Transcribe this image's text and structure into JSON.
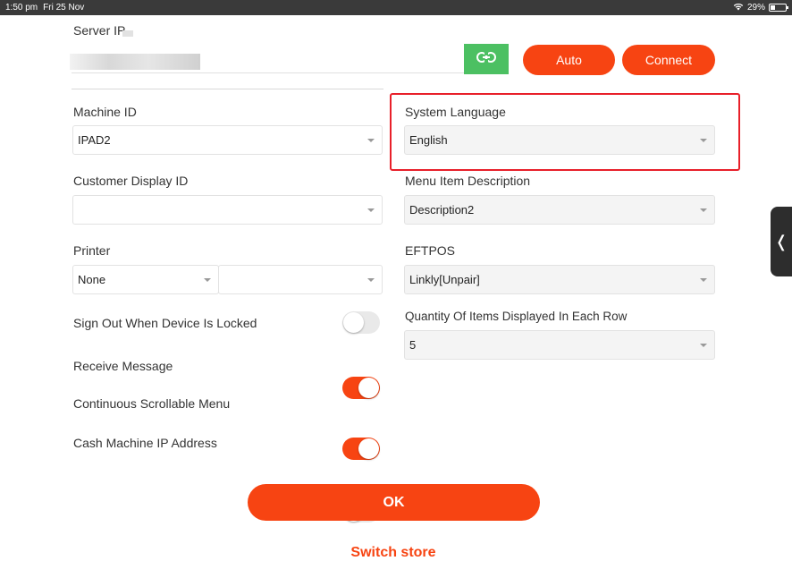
{
  "status_bar": {
    "time": "1:50 pm",
    "date": "Fri 25 Nov",
    "battery": "29%",
    "battery_level": 0.29,
    "wifi_icon": "wifi-icon"
  },
  "server": {
    "label": "Server IP",
    "value": ""
  },
  "buttons": {
    "auto": "Auto",
    "connect": "Connect",
    "ok": "OK",
    "switch_store": "Switch store"
  },
  "machine_id": {
    "label": "Machine ID",
    "value": "IPAD2"
  },
  "customer_display_id": {
    "label": "Customer Display ID",
    "value": ""
  },
  "printer": {
    "label": "Printer",
    "value1": "None",
    "value2": ""
  },
  "system_language": {
    "label": "System Language",
    "value": "English"
  },
  "menu_item_description": {
    "label": "Menu Item Description",
    "value": "Description2"
  },
  "eftpos": {
    "label": "EFTPOS",
    "value": "Linkly[Unpair]"
  },
  "quantity_per_row": {
    "label": "Quantity Of Items Displayed In Each Row",
    "value": "5"
  },
  "toggles": [
    {
      "label": "Sign Out When Device Is Locked",
      "on": false
    },
    {
      "label": "Receive Message",
      "on": true
    },
    {
      "label": "Continuous Scrollable Menu",
      "on": true
    },
    {
      "label": "Cash Machine IP Address",
      "on": false
    }
  ],
  "colors": {
    "accent": "#f74412",
    "link_green": "#4cc062",
    "highlight": "#e8202a"
  }
}
